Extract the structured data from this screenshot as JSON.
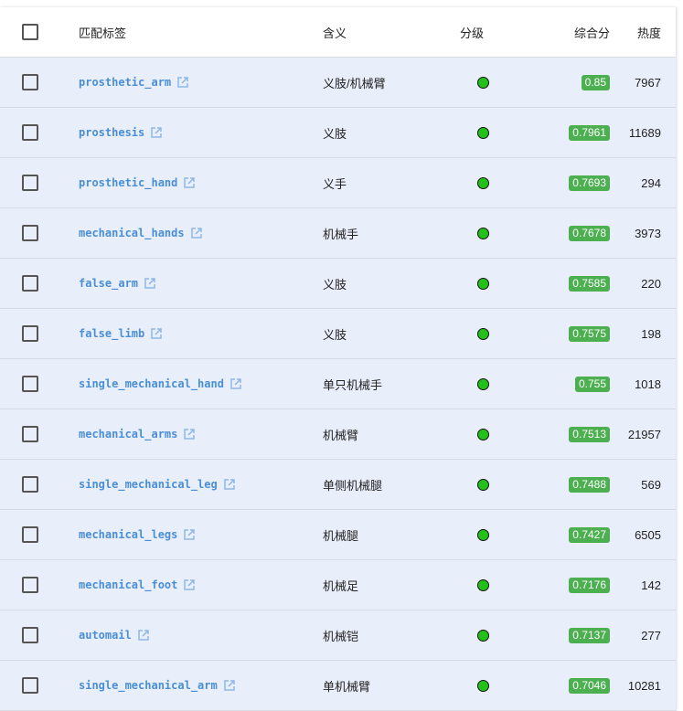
{
  "header": {
    "tag": "匹配标签",
    "meaning": "含义",
    "grade": "分级",
    "score": "综合分",
    "heat": "热度"
  },
  "rows": [
    {
      "tag": "prosthetic_arm",
      "meaning": "义肢/机械臂",
      "score": "0.85",
      "heat": "7967"
    },
    {
      "tag": "prosthesis",
      "meaning": "义肢",
      "score": "0.7961",
      "heat": "11689"
    },
    {
      "tag": "prosthetic_hand",
      "meaning": "义手",
      "score": "0.7693",
      "heat": "294"
    },
    {
      "tag": "mechanical_hands",
      "meaning": "机械手",
      "score": "0.7678",
      "heat": "3973"
    },
    {
      "tag": "false_arm",
      "meaning": "义肢",
      "score": "0.7585",
      "heat": "220"
    },
    {
      "tag": "false_limb",
      "meaning": "义肢",
      "score": "0.7575",
      "heat": "198"
    },
    {
      "tag": "single_mechanical_hand",
      "meaning": "单只机械手",
      "score": "0.755",
      "heat": "1018"
    },
    {
      "tag": "mechanical_arms",
      "meaning": "机械臂",
      "score": "0.7513",
      "heat": "21957"
    },
    {
      "tag": "single_mechanical_leg",
      "meaning": "单侧机械腿",
      "score": "0.7488",
      "heat": "569"
    },
    {
      "tag": "mechanical_legs",
      "meaning": "机械腿",
      "score": "0.7427",
      "heat": "6505"
    },
    {
      "tag": "mechanical_foot",
      "meaning": "机械足",
      "score": "0.7176",
      "heat": "142"
    },
    {
      "tag": "automail",
      "meaning": "机械铠",
      "score": "0.7137",
      "heat": "277"
    },
    {
      "tag": "single_mechanical_arm",
      "meaning": "单机械臂",
      "score": "0.7046",
      "heat": "10281"
    }
  ],
  "colors": {
    "row_bg": "#e8eefa",
    "link": "#4a8fd6",
    "grade_dot": "#22c11a",
    "score_badge": "#4caf50"
  },
  "icons": {
    "grade": "green-dot-icon",
    "external": "external-link-icon",
    "checkbox": "checkbox-icon"
  }
}
